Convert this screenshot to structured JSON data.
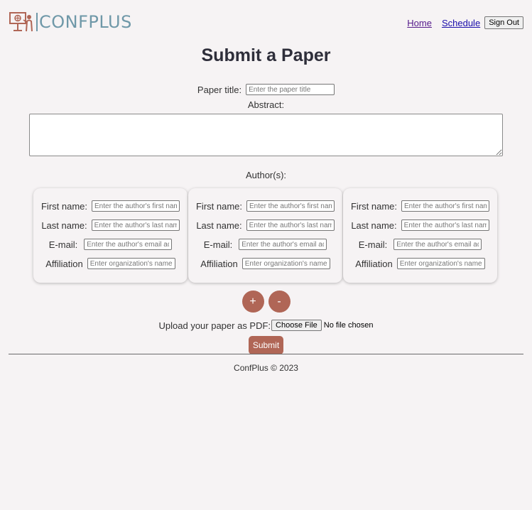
{
  "header": {
    "logo_text": "CONFPLUS",
    "nav": {
      "home": "Home",
      "schedule": "Schedule",
      "sign_out": "Sign Out"
    }
  },
  "page_title": "Submit a Paper",
  "form": {
    "paper_title_label": "Paper title:",
    "paper_title_placeholder": "Enter the paper title",
    "paper_title_value": "",
    "abstract_label": "Abstract:",
    "abstract_value": "",
    "authors_label": "Author(s):",
    "authors": [
      {
        "first_name_label": "First name:",
        "first_name_placeholder": "Enter the author's first name",
        "last_name_label": "Last name:",
        "last_name_placeholder": "Enter the author's last name",
        "email_label": "E-mail:",
        "email_placeholder": "Enter the author's email address",
        "affiliation_label": "Affiliation",
        "affiliation_placeholder": "Enter organization's name"
      },
      {
        "first_name_label": "First name:",
        "first_name_placeholder": "Enter the author's first name",
        "last_name_label": "Last name:",
        "last_name_placeholder": "Enter the author's last name",
        "email_label": "E-mail:",
        "email_placeholder": "Enter the author's email address",
        "affiliation_label": "Affiliation",
        "affiliation_placeholder": "Enter organization's name"
      },
      {
        "first_name_label": "First name:",
        "first_name_placeholder": "Enter the author's first name",
        "last_name_label": "Last name:",
        "last_name_placeholder": "Enter the author's last name",
        "email_label": "E-mail:",
        "email_placeholder": "Enter the author's email address",
        "affiliation_label": "Affiliation",
        "affiliation_placeholder": "Enter organization's name"
      }
    ],
    "add_author": "+",
    "remove_author": "-",
    "upload_label": "Upload your paper as PDF:",
    "choose_file": "Choose File",
    "no_file": "No file chosen",
    "submit": "Submit"
  },
  "footer": {
    "text": "ConfPlus © 2023"
  },
  "colors": {
    "accent": "#b06656",
    "logo": "#6f98a8",
    "background": "#f6f3f4"
  },
  "icons": {
    "logo": "presenter-board-icon"
  }
}
